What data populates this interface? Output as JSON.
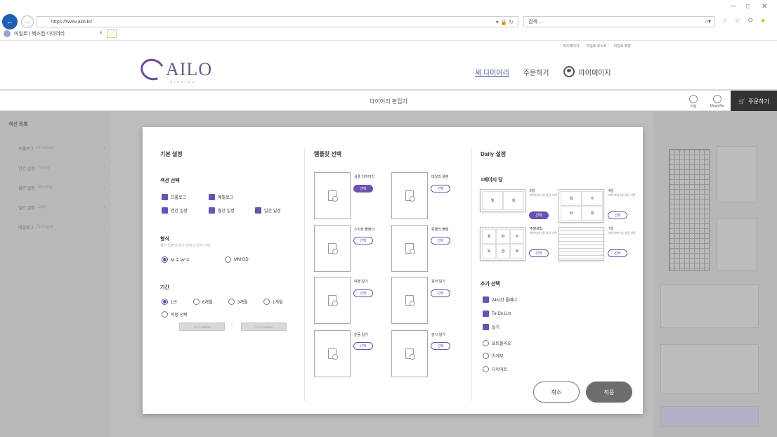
{
  "browser": {
    "url": "https://www.ailo.kr/",
    "search_text": "검색...",
    "tab_title": "마일로 | 핵스컴 다이어리",
    "window_controls": [
      "─",
      "□",
      "✕"
    ]
  },
  "site": {
    "top_menu": [
      "마이페이지",
      "마일로 포스트",
      "마일로 매장"
    ],
    "logo_text": "AILO",
    "logo_sub": "DIARIES",
    "nav": [
      "새 다이어리",
      "주문하기",
      "마이페이지"
    ]
  },
  "editor": {
    "title": "다이어리 편집기",
    "header_buttons": [
      "저장",
      "Magnifier"
    ],
    "order_label": "주문하기",
    "left_title": "섹션 목록",
    "left_items": [
      {
        "label": "프롤로그",
        "sub": "Prologue"
      },
      {
        "label": "연간 일정",
        "sub": "Yearly"
      },
      {
        "label": "월간 일정",
        "sub": "Monthly"
      },
      {
        "label": "일간 일정",
        "sub": "Daily"
      },
      {
        "label": "에필로그",
        "sub": "Epilogue"
      }
    ]
  },
  "modal": {
    "col1": {
      "title": "기본 설정",
      "section_label": "섹션 선택",
      "sections": [
        {
          "label": "프롤로그",
          "checked": true
        },
        {
          "label": "에필로그",
          "checked": true
        },
        {
          "label": "연간 일정",
          "checked": true
        },
        {
          "label": "월간 일정",
          "checked": true
        },
        {
          "label": "일간 일정",
          "checked": true
        }
      ],
      "format_label": "형식",
      "format_hint": "월간 일정과 일간 일정의 형식 선택",
      "formats": [
        {
          "label": "M 수·W 수",
          "checked": true
        },
        {
          "label": "MM·DD",
          "checked": false
        }
      ],
      "period_label": "기간",
      "periods": [
        {
          "label": "1년",
          "checked": true
        },
        {
          "label": "6개월",
          "checked": false
        },
        {
          "label": "3개월",
          "checked": false
        },
        {
          "label": "1개월",
          "checked": false
        },
        {
          "label": "직접 선택",
          "checked": false
        }
      ],
      "date_from": "YYYY/MM/DD",
      "date_sep": "~",
      "date_to": "YYYY/MM/DD"
    },
    "col2": {
      "title": "템플릿 선택",
      "templates": [
        {
          "label": "심플 다이어리",
          "selected": true
        },
        {
          "label": "데일리 플랜",
          "selected": false
        },
        {
          "label": "스마트 플래너",
          "selected": false
        },
        {
          "label": "위클리 플랜",
          "selected": false
        },
        {
          "label": "여행 일기",
          "selected": false
        },
        {
          "label": "육아 일기",
          "selected": false
        },
        {
          "label": "운동 일기",
          "selected": false
        },
        {
          "label": "감사 일기",
          "selected": false
        }
      ],
      "select_label": "선택"
    },
    "col3": {
      "title": "Daily 설정",
      "layout_label": "1페이지 당",
      "layouts": [
        {
          "label": "2일",
          "sub": "페이지에 2일 일정 기록",
          "selected": true
        },
        {
          "label": "4일",
          "sub": "페이지에 4일 일정 기록",
          "selected": false
        },
        {
          "label": "주말포함",
          "sub": "페이지에 7일 일정 기록",
          "selected": false
        },
        {
          "label": "7일",
          "sub": "페이지에 7일 일정 기록",
          "selected": false
        }
      ],
      "layout_cells": {
        "two": [
          "월",
          "화"
        ],
        "four": [
          "월",
          "수",
          "화",
          "목"
        ],
        "six": [
          "월",
          "화",
          "수",
          "목",
          "금",
          "토"
        ]
      },
      "select_label": "선택",
      "options_label": "추가 선택",
      "options": [
        {
          "label": "24시간 플래너",
          "checked": true
        },
        {
          "label": "To-Do List",
          "checked": true
        },
        {
          "label": "일기",
          "checked": true
        },
        {
          "label": "포트폴리오",
          "checked": false
        },
        {
          "label": "가계부",
          "checked": false
        },
        {
          "label": "다이어트",
          "checked": false
        }
      ]
    },
    "cancel_label": "취소",
    "apply_label": "적용"
  },
  "colors": {
    "accent": "#6b52ae",
    "apply_bg": "#6d6d6d",
    "order_bg": "#333333"
  }
}
